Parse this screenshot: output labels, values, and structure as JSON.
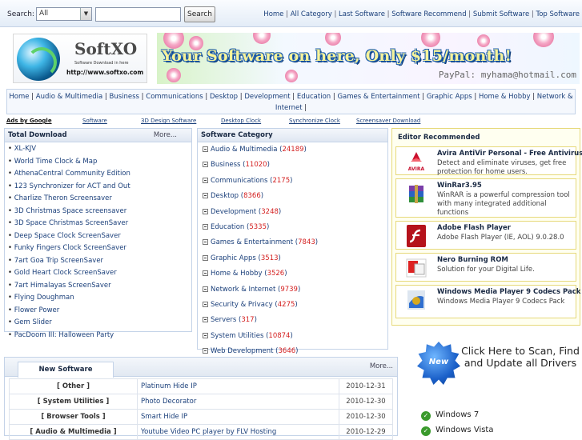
{
  "search": {
    "label": "Search:",
    "scope_selected": "All",
    "query": "",
    "button_label": "Search"
  },
  "top_nav": [
    "Home",
    "All Category",
    "Last Software",
    "Software Recommend",
    "Submit Software",
    "Top Software"
  ],
  "logo": {
    "brand": "SoftXO",
    "tagline": "Software Download in here",
    "url": "http://www.softxo.com"
  },
  "banner": {
    "headline": "Your Software on here, Only $15/month!",
    "paypal": "PayPal: myhama@hotmail.com"
  },
  "category_nav": [
    "Home",
    "Audio & Multimedia",
    "Business",
    "Communications",
    "Desktop",
    "Development",
    "Education",
    "Games & Entertainment",
    "Graphic Apps",
    "Home & Hobby",
    "Network & Internet"
  ],
  "ads_row": {
    "ads_by": "Ads by Google",
    "links": [
      "Software",
      "3D Design Software",
      "Desktop Clock",
      "Synchronize Clock",
      "Screensaver Download"
    ]
  },
  "total_download": {
    "title": "Total Download",
    "more": "More...",
    "items": [
      "XL-KJV",
      "World Time Clock & Map",
      "AthenaCentral Community Edition",
      "123 Synchronizer for ACT and Out",
      "Charlize Theron Screensaver",
      "3D Christmas Space screensaver",
      "3D Space Christmas ScreenSaver",
      "Deep Space Clock ScreenSaver",
      "Funky Fingers Clock ScreenSaver",
      "7art Goa Trip ScreenSaver",
      "Gold Heart Clock ScreenSaver",
      "7art Himalayas ScreenSaver",
      "Flying Doughman",
      "Flower Power",
      "Gem Slider",
      "PacDoom III: Halloween Party"
    ]
  },
  "software_category": {
    "title": "Software Category",
    "items": [
      {
        "name": "Audio & Multimedia",
        "count": "24189"
      },
      {
        "name": "Business",
        "count": "11020"
      },
      {
        "name": "Communications",
        "count": "2175"
      },
      {
        "name": "Desktop",
        "count": "8366"
      },
      {
        "name": "Development",
        "count": "3248"
      },
      {
        "name": "Education",
        "count": "5335"
      },
      {
        "name": "Games & Entertainment",
        "count": "7843"
      },
      {
        "name": "Graphic Apps",
        "count": "3513"
      },
      {
        "name": "Home & Hobby",
        "count": "3526"
      },
      {
        "name": "Network & Internet",
        "count": "9739"
      },
      {
        "name": "Security & Privacy",
        "count": "4275"
      },
      {
        "name": "Servers",
        "count": "317"
      },
      {
        "name": "System Utilities",
        "count": "10874"
      },
      {
        "name": "Web Development",
        "count": "3646"
      }
    ]
  },
  "editor": {
    "title": "Editor Recommended",
    "items": [
      {
        "name": "Avira AntiVir Personal - Free Antivirus",
        "desc": "Detect and eliminate viruses, get free protection for home users.",
        "icon": "avira-icon"
      },
      {
        "name": "WinRar3.95",
        "desc": "WinRAR is a powerful compression tool with many integrated additional functions",
        "icon": "winrar-icon"
      },
      {
        "name": "Adobe Flash Player",
        "desc": "Adobe Flash Player (IE, AOL) 9.0.28.0",
        "icon": "flash-icon"
      },
      {
        "name": "Nero Burning ROM",
        "desc": "Solution for your Digital Life.",
        "icon": "nero-icon"
      },
      {
        "name": "Windows Media Player 9 Codecs Pack",
        "desc": "Windows Media Player 9 Codecs Pack",
        "icon": "wmp-icon"
      }
    ]
  },
  "new_software": {
    "tab": "New Software",
    "more": "More...",
    "rows": [
      {
        "category": "[ Other ]",
        "name": "Platinum Hide IP",
        "date": "2010-12-31"
      },
      {
        "category": "[ System Utilities ]",
        "name": "Photo Decorator",
        "date": "2010-12-30"
      },
      {
        "category": "[ Browser Tools ]",
        "name": "Smart Hide IP",
        "date": "2010-12-30"
      },
      {
        "category": "[ Audio & Multimedia ]",
        "name": "Youtube Video PC player by FLV Hosting",
        "date": "2010-12-29"
      }
    ]
  },
  "ad_box": {
    "badge": "New",
    "headline": "Click Here to Scan, Find and Update all Drivers",
    "os_list": [
      "Windows  7",
      "Windows  Vista"
    ]
  },
  "colors": {
    "accent": "#1a3f7a",
    "count_red": "#d42020",
    "editor_bg": "#fffff0"
  }
}
